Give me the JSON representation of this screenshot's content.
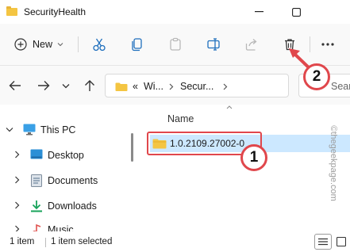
{
  "window": {
    "title": "SecurityHealth",
    "minimize_icon": "minimize-icon",
    "maximize_icon": "maximize-icon"
  },
  "toolbar": {
    "new_label": "New",
    "icons": [
      "new-plus-icon",
      "chevron-down-icon",
      "cut-icon",
      "copy-icon",
      "paste-icon",
      "rename-icon",
      "share-icon",
      "delete-icon",
      "more-icon"
    ]
  },
  "address_bar": {
    "overflow": "«",
    "crumbs": [
      "Wi...",
      "Secur..."
    ],
    "search_placeholder": "Searc"
  },
  "sidebar": {
    "items": [
      {
        "label": "This PC",
        "icon": "monitor-icon",
        "expanded": true
      },
      {
        "label": "Desktop",
        "icon": "desktop-icon"
      },
      {
        "label": "Documents",
        "icon": "documents-icon"
      },
      {
        "label": "Downloads",
        "icon": "download-icon"
      },
      {
        "label": "Music",
        "icon": "music-icon"
      }
    ]
  },
  "content": {
    "column_header": "Name",
    "files": [
      {
        "name": "1.0.2109.27002-0",
        "type": "folder",
        "selected": true
      }
    ]
  },
  "status": {
    "count": "1 item",
    "selected": "1 item selected"
  },
  "annotations": {
    "badge_1": "1",
    "badge_2": "2",
    "watermark": "©thegeekpage.com"
  },
  "colors": {
    "accent_red": "#e0474c",
    "selection": "#cce8ff",
    "folder": "#f4c542"
  }
}
